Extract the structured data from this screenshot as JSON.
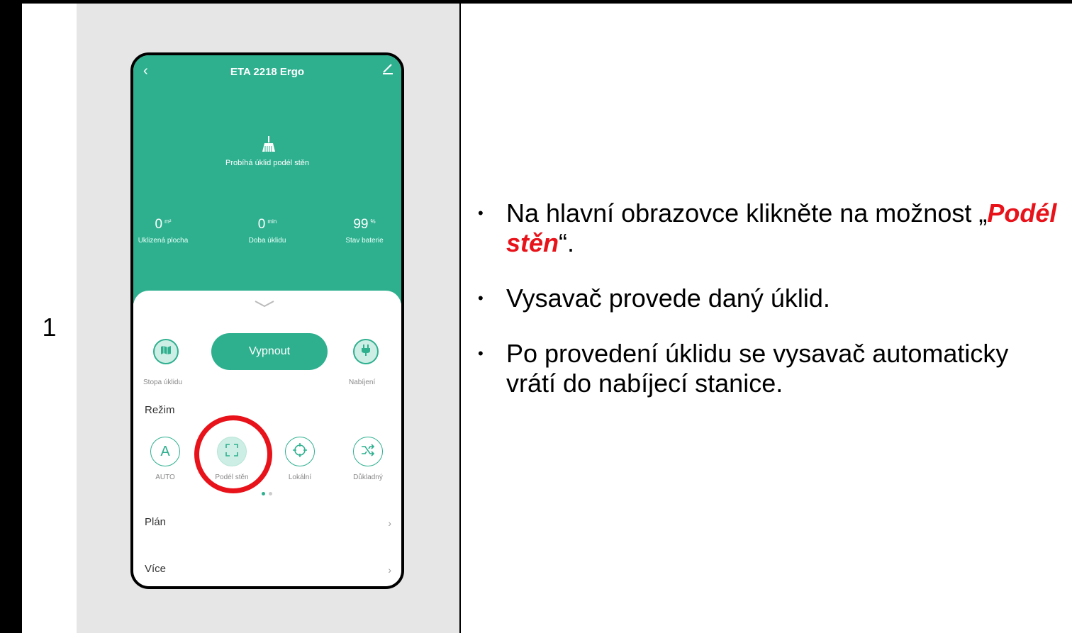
{
  "step": {
    "number": "1"
  },
  "phone": {
    "title": "ETA 2218 Ergo",
    "status": "Probíhá úklid podél stěn",
    "stats": [
      {
        "value": "0",
        "unit": "m²",
        "label": "Uklizená plocha"
      },
      {
        "value": "0",
        "unit": "min",
        "label": "Doba úklidu"
      },
      {
        "value": "99",
        "unit": "%",
        "label": "Stav baterie"
      }
    ],
    "controls": {
      "map_label": "Stopa úklidu",
      "power_label": "Vypnout",
      "charge_label": "Nabíjení"
    },
    "mode_section": "Režim",
    "modes": [
      {
        "label": "AUTO",
        "icon": "auto-a-icon",
        "active": false
      },
      {
        "label": "Podél stěn",
        "icon": "wall-frame-icon",
        "active": true
      },
      {
        "label": "Lokální",
        "icon": "spot-target-icon",
        "active": false
      },
      {
        "label": "Důkladný",
        "icon": "shuffle-icon",
        "active": false
      }
    ],
    "rows": [
      {
        "label": "Plán"
      },
      {
        "label": "Více"
      }
    ],
    "accent_color": "#2eb08f"
  },
  "instructions": {
    "bullet1_prefix": "Na hlavní obrazovce klikněte na možnost „",
    "bullet1_highlight": "Podél stěn",
    "bullet1_suffix": "“.",
    "bullet2": "Vysavač provede daný úklid.",
    "bullet3": "Po provedení úklidu se vysavač automaticky vrátí do nabíjecí stanice.",
    "highlight_color": "#e8131a"
  }
}
